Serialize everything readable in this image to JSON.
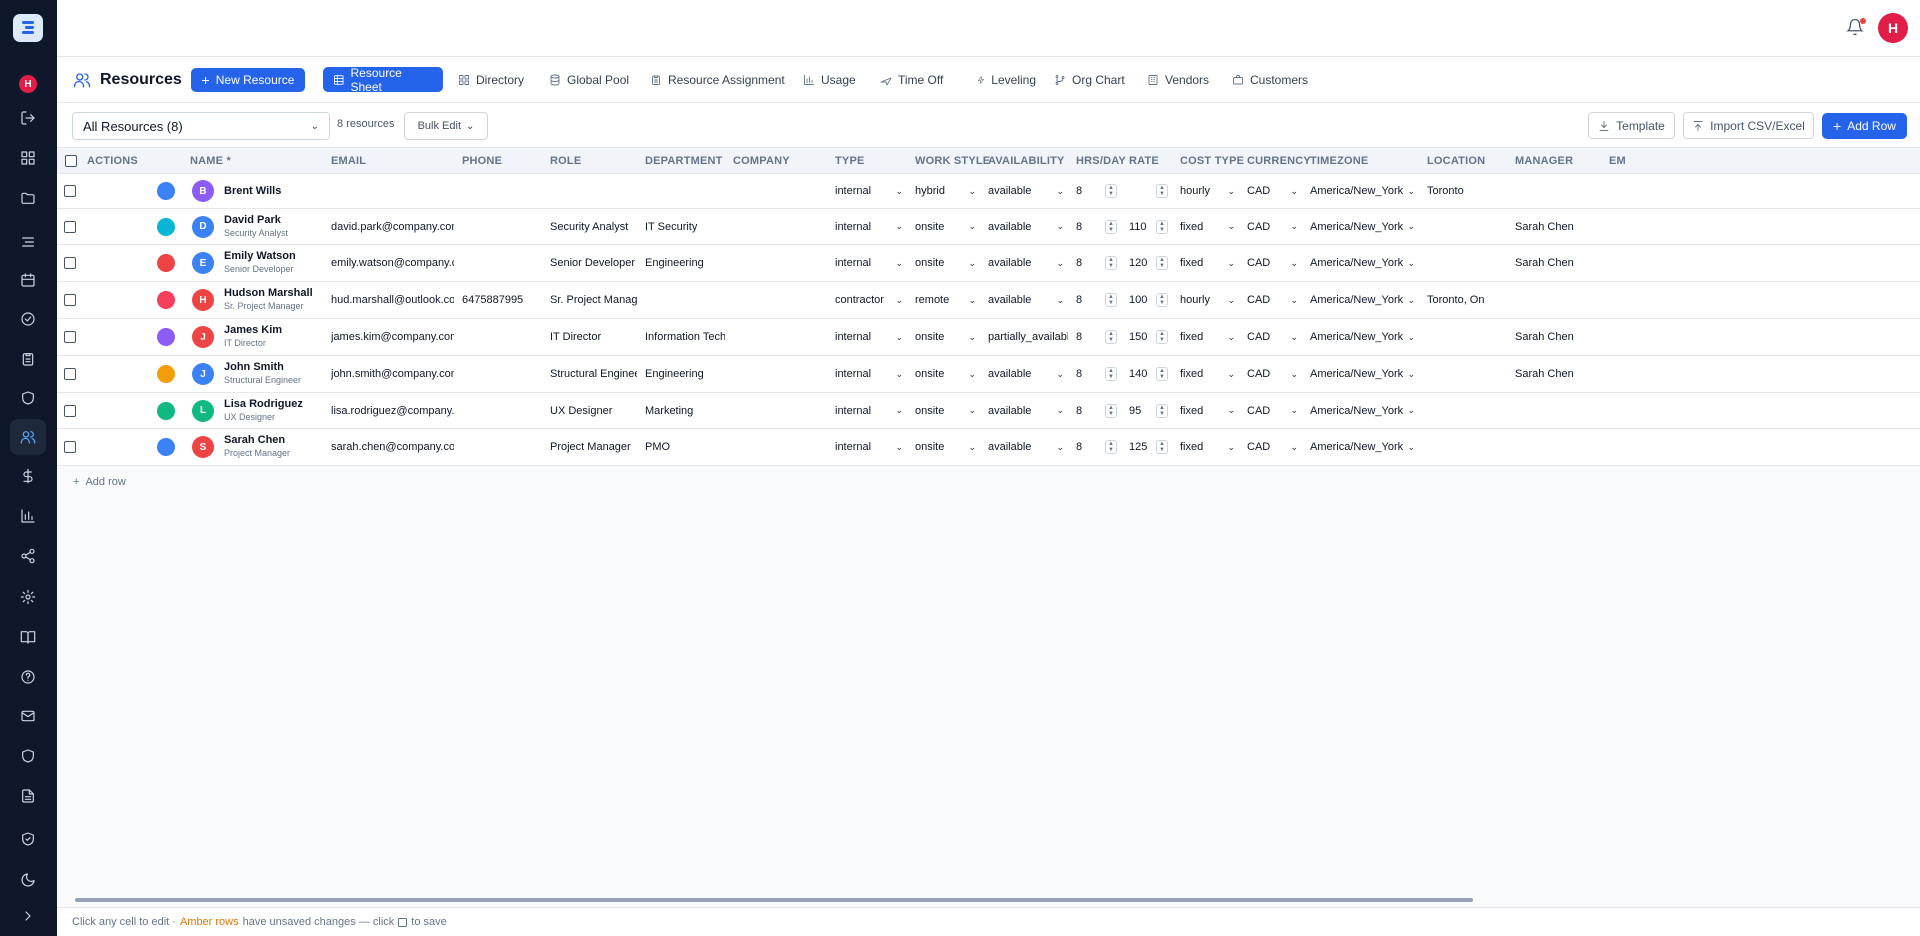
{
  "rail": {
    "avatar_initial": "H",
    "icons": [
      "logout-icon",
      "dashboard-icon",
      "folder-icon",
      "list-icon",
      "calendar-icon",
      "check-circle-icon",
      "clipboard-icon",
      "shield-icon",
      "users-icon",
      "dollar-icon",
      "bar-chart-icon",
      "share-icon",
      "gear-icon",
      "book-icon",
      "help-icon",
      "mail-icon",
      "shield-icon",
      "file-icon",
      "shield-check-icon",
      "moon-icon",
      "chevron-right-icon"
    ],
    "active_icon": "users-icon"
  },
  "topbar": {
    "user_initial": "H",
    "notification_dot": true
  },
  "page": {
    "title": "Resources",
    "new_button": "New Resource"
  },
  "tabs": [
    {
      "label": "Resource Sheet",
      "icon": "table-icon",
      "active": true
    },
    {
      "label": "Directory",
      "icon": "grid-icon",
      "active": false
    },
    {
      "label": "Global Pool",
      "icon": "database-icon",
      "active": false
    },
    {
      "label": "Resource Assignment",
      "icon": "clipboard-icon",
      "active": false
    },
    {
      "label": "Usage",
      "icon": "bar-chart-icon",
      "active": false
    },
    {
      "label": "Time Off",
      "icon": "plane-icon",
      "active": false
    },
    {
      "label": "Leveling",
      "icon": "zap-icon",
      "active": false
    },
    {
      "label": "Org Chart",
      "icon": "branch-icon",
      "active": false
    },
    {
      "label": "Vendors",
      "icon": "building-icon",
      "active": false
    },
    {
      "label": "Customers",
      "icon": "briefcase-icon",
      "active": false
    }
  ],
  "toolbar": {
    "filter_value": "All Resources (8)",
    "count_text": "8 resources",
    "bulk_edit": "Bulk Edit",
    "template": "Template",
    "import": "Import CSV/Excel",
    "add_row": "Add Row"
  },
  "columns": [
    "ACTIONS",
    "NAME *",
    "EMAIL",
    "PHONE",
    "ROLE",
    "DEPARTMENT",
    "COMPANY",
    "TYPE",
    "WORK STYLE",
    "AVAILABILITY",
    "HRS/DAY",
    "RATE",
    "COST TYPE",
    "CURRENCY",
    "TIMEZONE",
    "LOCATION",
    "MANAGER",
    "EM"
  ],
  "rows": [
    {
      "color": "#3b82f6",
      "initial": "B",
      "avatar": "#8b5cf6",
      "name": "Brent Wills",
      "title": "",
      "email": "",
      "phone": "",
      "role": "",
      "department": "",
      "company": "",
      "type": "internal",
      "work_style": "hybrid",
      "availability": "available",
      "hrs": "8",
      "rate": "",
      "cost_type": "hourly",
      "currency": "CAD",
      "timezone": "America/New_York",
      "location": "Toronto",
      "manager": ""
    },
    {
      "color": "#06b6d4",
      "initial": "D",
      "avatar": "#3b82f6",
      "name": "David Park",
      "title": "Security Analyst",
      "email": "david.park@company.com",
      "phone": "",
      "role": "Security Analyst",
      "department": "IT Security",
      "company": "",
      "type": "internal",
      "work_style": "onsite",
      "availability": "available",
      "hrs": "8",
      "rate": "110",
      "cost_type": "fixed",
      "currency": "CAD",
      "timezone": "America/New_York",
      "location": "",
      "manager": "Sarah Chen"
    },
    {
      "color": "#ef4444",
      "initial": "E",
      "avatar": "#3b82f6",
      "name": "Emily Watson",
      "title": "Senior Developer",
      "email": "emily.watson@company.com",
      "phone": "",
      "role": "Senior Developer",
      "department": "Engineering",
      "company": "",
      "type": "internal",
      "work_style": "onsite",
      "availability": "available",
      "hrs": "8",
      "rate": "120",
      "cost_type": "fixed",
      "currency": "CAD",
      "timezone": "America/New_York",
      "location": "",
      "manager": "Sarah Chen"
    },
    {
      "color": "#f43f5e",
      "initial": "H",
      "avatar": "#ef4444",
      "name": "Hudson Marshall",
      "title": "Sr. Project Manager",
      "email": "hud.marshall@outlook.com",
      "phone": "6475887995",
      "role": "Sr. Project Manager",
      "department": "",
      "company": "",
      "type": "contractor",
      "work_style": "remote",
      "availability": "available",
      "hrs": "8",
      "rate": "100",
      "cost_type": "hourly",
      "currency": "CAD",
      "timezone": "America/New_York",
      "location": "Toronto, On",
      "manager": ""
    },
    {
      "color": "#8b5cf6",
      "initial": "J",
      "avatar": "#ef4444",
      "name": "James Kim",
      "title": "IT Director",
      "email": "james.kim@company.com",
      "phone": "",
      "role": "IT Director",
      "department": "Information Techn",
      "company": "",
      "type": "internal",
      "work_style": "onsite",
      "availability": "partially_availabl",
      "hrs": "8",
      "rate": "150",
      "cost_type": "fixed",
      "currency": "CAD",
      "timezone": "America/New_York",
      "location": "",
      "manager": "Sarah Chen"
    },
    {
      "color": "#f59e0b",
      "initial": "J",
      "avatar": "#3b82f6",
      "name": "John Smith",
      "title": "Structural Engineer",
      "email": "john.smith@company.com",
      "phone": "",
      "role": "Structural Engineer",
      "department": "Engineering",
      "company": "",
      "type": "internal",
      "work_style": "onsite",
      "availability": "available",
      "hrs": "8",
      "rate": "140",
      "cost_type": "fixed",
      "currency": "CAD",
      "timezone": "America/New_York",
      "location": "",
      "manager": "Sarah Chen"
    },
    {
      "color": "#10b981",
      "initial": "L",
      "avatar": "#10b981",
      "name": "Lisa Rodriguez",
      "title": "UX Designer",
      "email": "lisa.rodriguez@company.com",
      "phone": "",
      "role": "UX Designer",
      "department": "Marketing",
      "company": "",
      "type": "internal",
      "work_style": "onsite",
      "availability": "available",
      "hrs": "8",
      "rate": "95",
      "cost_type": "fixed",
      "currency": "CAD",
      "timezone": "America/New_York",
      "location": "",
      "manager": ""
    },
    {
      "color": "#3b82f6",
      "initial": "S",
      "avatar": "#ef4444",
      "name": "Sarah Chen",
      "title": "Project Manager",
      "email": "sarah.chen@company.com",
      "phone": "",
      "role": "Project Manager",
      "department": "PMO",
      "company": "",
      "type": "internal",
      "work_style": "onsite",
      "availability": "available",
      "hrs": "8",
      "rate": "125",
      "cost_type": "fixed",
      "currency": "CAD",
      "timezone": "America/New_York",
      "location": "",
      "manager": ""
    }
  ],
  "grid": {
    "add_row_label": "Add row"
  },
  "footer": {
    "part1": "Click any cell to edit ·",
    "amber": "Amber rows",
    "part2": "have unsaved changes — click",
    "part3": "to save"
  },
  "colors": {
    "accent": "#2563eb",
    "rail_bg": "#0f172a",
    "amber": "#d97706"
  }
}
